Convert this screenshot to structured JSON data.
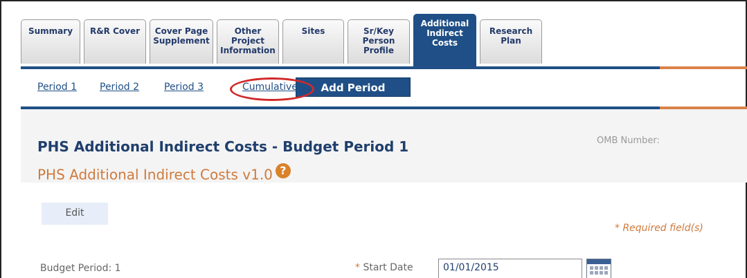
{
  "tabs": [
    {
      "lines": [
        "Summary"
      ],
      "active": false
    },
    {
      "lines": [
        "R&R Cover"
      ],
      "active": false
    },
    {
      "lines": [
        "Cover Page",
        "Supplement"
      ],
      "active": false
    },
    {
      "lines": [
        "Other",
        "Project",
        "Information"
      ],
      "active": false
    },
    {
      "lines": [
        "Sites"
      ],
      "active": false
    },
    {
      "lines": [
        "Sr/Key",
        "Person",
        "Profile"
      ],
      "active": false
    },
    {
      "lines": [
        "Additional",
        "Indirect",
        "Costs"
      ],
      "active": true
    },
    {
      "lines": [
        "Research",
        "Plan"
      ],
      "active": false
    }
  ],
  "periods": {
    "links": [
      "Period 1",
      "Period 2",
      "Period 3",
      "Cumulative"
    ],
    "add_label": "Add Period"
  },
  "form": {
    "title": "PHS Additional Indirect Costs - Budget Period 1",
    "subtitle": "PHS Additional Indirect Costs v1.0",
    "help_symbol": "?",
    "omb_label": "OMB Number:"
  },
  "body": {
    "edit_label": "Edit",
    "required_note": "* Required field(s)",
    "budget_period": "Budget Period: 1",
    "start_date_star": "*",
    "start_date_label": "Start Date",
    "start_date_value": "01/01/2015",
    "calendar_icon": "calendar-icon"
  },
  "colors": {
    "brand": "#1f4f86",
    "accent": "#cf7a3c",
    "highlight": "#d12a2a"
  }
}
